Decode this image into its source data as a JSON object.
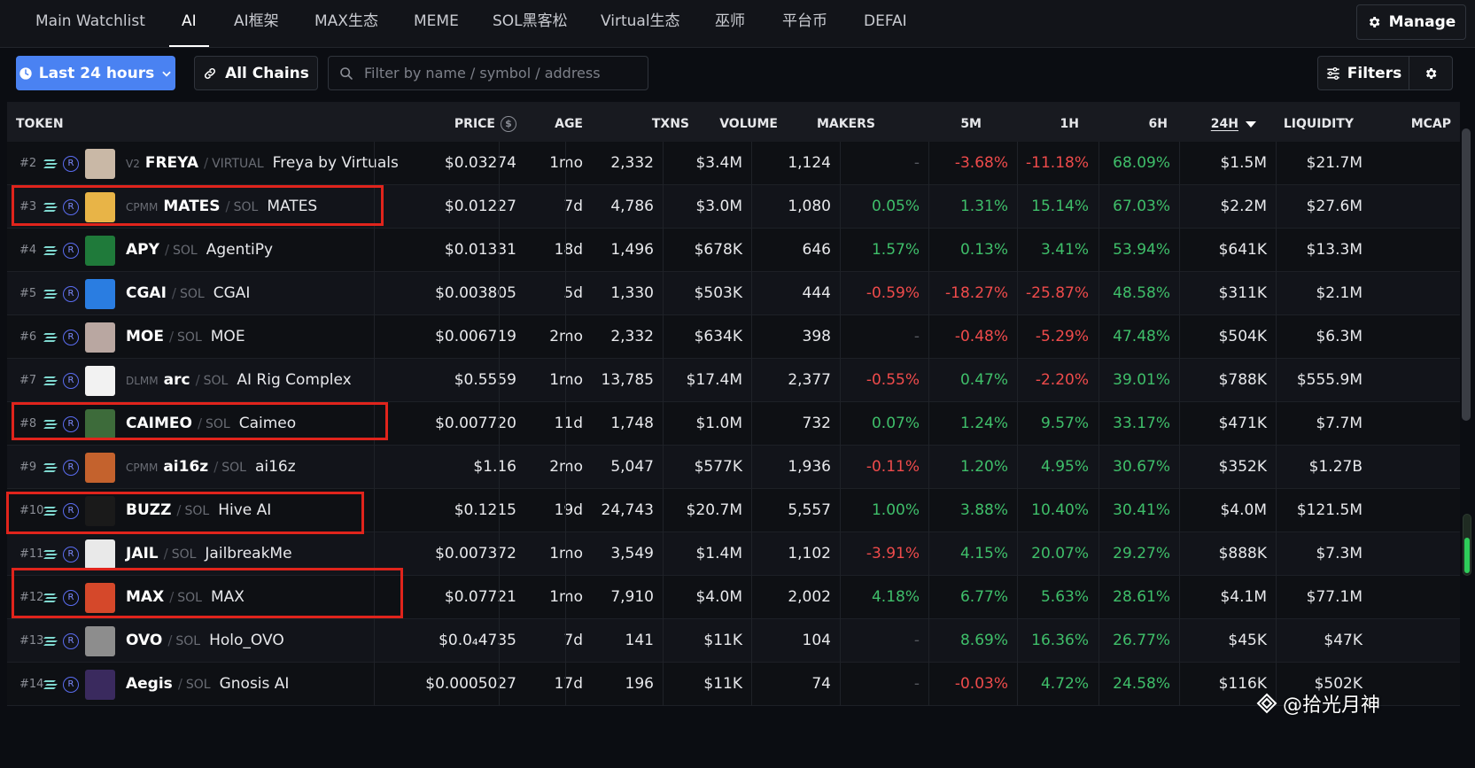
{
  "tabs": [
    "Main Watchlist",
    "AI",
    "AI框架",
    "MAX生态",
    "MEME",
    "SOL黑客松",
    "Virtual生态",
    "巫师",
    "平台币",
    "DEFAI"
  ],
  "active_tab": "AI",
  "manage_label": "Manage",
  "toolbar": {
    "time_label": "Last 24 hours",
    "chains_label": "All Chains",
    "search_placeholder": "Filter by name / symbol / address",
    "filters_label": "Filters"
  },
  "columns": {
    "token": "TOKEN",
    "price": "PRICE",
    "age": "AGE",
    "txns": "TXNS",
    "volume": "VOLUME",
    "makers": "MAKERS",
    "m5": "5M",
    "h1": "1H",
    "h6": "6H",
    "h24": "24H",
    "liquidity": "LIQUIDITY",
    "mcap": "MCAP"
  },
  "rows": [
    {
      "rank": "#2",
      "tag": "V2",
      "symbol": "FREYA",
      "quote": "VIRTUAL",
      "name": "Freya by Virtuals",
      "price": "$0.03274",
      "age": "1mo",
      "txns": "2,332",
      "volume": "$3.4M",
      "makers": "1,124",
      "m5": "-",
      "h1": "-3.68%",
      "h6": "-11.18%",
      "h24": "68.09%",
      "liquidity": "$1.5M",
      "mcap": "$21.7M",
      "avatar_color": "#c9b8a6"
    },
    {
      "rank": "#3",
      "tag": "CPMM",
      "symbol": "MATES",
      "quote": "SOL",
      "name": "MATES",
      "price": "$0.01227",
      "age": "7d",
      "txns": "4,786",
      "volume": "$3.0M",
      "makers": "1,080",
      "m5": "0.05%",
      "h1": "1.31%",
      "h6": "15.14%",
      "h24": "67.03%",
      "liquidity": "$2.2M",
      "mcap": "$27.6M",
      "avatar_color": "#e8b447"
    },
    {
      "rank": "#4",
      "tag": "",
      "symbol": "APY",
      "quote": "SOL",
      "name": "AgentiPy",
      "price": "$0.01331",
      "age": "18d",
      "txns": "1,496",
      "volume": "$678K",
      "makers": "646",
      "m5": "1.57%",
      "h1": "0.13%",
      "h6": "3.41%",
      "h24": "53.94%",
      "liquidity": "$641K",
      "mcap": "$13.3M",
      "avatar_color": "#1f7a3a"
    },
    {
      "rank": "#5",
      "tag": "",
      "symbol": "CGAI",
      "quote": "SOL",
      "name": "CGAI",
      "price": "$0.003805",
      "age": "5d",
      "txns": "1,330",
      "volume": "$503K",
      "makers": "444",
      "m5": "-0.59%",
      "h1": "-18.27%",
      "h6": "-25.87%",
      "h24": "48.58%",
      "liquidity": "$311K",
      "mcap": "$2.1M",
      "avatar_color": "#2a7de1"
    },
    {
      "rank": "#6",
      "tag": "",
      "symbol": "MOE",
      "quote": "SOL",
      "name": "MOE",
      "price": "$0.006719",
      "age": "2mo",
      "txns": "2,332",
      "volume": "$634K",
      "makers": "398",
      "m5": "-",
      "h1": "-0.48%",
      "h6": "-5.29%",
      "h24": "47.48%",
      "liquidity": "$504K",
      "mcap": "$6.3M",
      "avatar_color": "#b9a7a1"
    },
    {
      "rank": "#7",
      "tag": "DLMM",
      "symbol": "arc",
      "quote": "SOL",
      "name": "AI Rig Complex",
      "price": "$0.5559",
      "age": "1mo",
      "txns": "13,785",
      "volume": "$17.4M",
      "makers": "2,377",
      "m5": "-0.55%",
      "h1": "0.47%",
      "h6": "-2.20%",
      "h24": "39.01%",
      "liquidity": "$788K",
      "mcap": "$555.9M",
      "avatar_color": "#f2f2f2"
    },
    {
      "rank": "#8",
      "tag": "",
      "symbol": "CAIMEO",
      "quote": "SOL",
      "name": "Caimeo",
      "price": "$0.007720",
      "age": "11d",
      "txns": "1,748",
      "volume": "$1.0M",
      "makers": "732",
      "m5": "0.07%",
      "h1": "1.24%",
      "h6": "9.57%",
      "h24": "33.17%",
      "liquidity": "$471K",
      "mcap": "$7.7M",
      "avatar_color": "#3d6b3a"
    },
    {
      "rank": "#9",
      "tag": "CPMM",
      "symbol": "ai16z",
      "quote": "SOL",
      "name": "ai16z",
      "price": "$1.16",
      "age": "2mo",
      "txns": "5,047",
      "volume": "$577K",
      "makers": "1,936",
      "m5": "-0.11%",
      "h1": "1.20%",
      "h6": "4.95%",
      "h24": "30.67%",
      "liquidity": "$352K",
      "mcap": "$1.27B",
      "avatar_color": "#c4622d"
    },
    {
      "rank": "#10",
      "tag": "",
      "symbol": "BUZZ",
      "quote": "SOL",
      "name": "Hive AI",
      "price": "$0.1215",
      "age": "19d",
      "txns": "24,743",
      "volume": "$20.7M",
      "makers": "5,557",
      "m5": "1.00%",
      "h1": "3.88%",
      "h6": "10.40%",
      "h24": "30.41%",
      "liquidity": "$4.0M",
      "mcap": "$121.5M",
      "avatar_color": "#1a1a1a"
    },
    {
      "rank": "#11",
      "tag": "",
      "symbol": "JAIL",
      "quote": "SOL",
      "name": "JailbreakMe",
      "price": "$0.007372",
      "age": "1mo",
      "txns": "3,549",
      "volume": "$1.4M",
      "makers": "1,102",
      "m5": "-3.91%",
      "h1": "4.15%",
      "h6": "20.07%",
      "h24": "29.27%",
      "liquidity": "$888K",
      "mcap": "$7.3M",
      "avatar_color": "#e9e9e9"
    },
    {
      "rank": "#12",
      "tag": "",
      "symbol": "MAX",
      "quote": "SOL",
      "name": "MAX",
      "price": "$0.07721",
      "age": "1mo",
      "txns": "7,910",
      "volume": "$4.0M",
      "makers": "2,002",
      "m5": "4.18%",
      "h1": "6.77%",
      "h6": "5.63%",
      "h24": "28.61%",
      "liquidity": "$4.1M",
      "mcap": "$77.1M",
      "avatar_color": "#d5482a"
    },
    {
      "rank": "#13",
      "tag": "",
      "symbol": "OVO",
      "quote": "SOL",
      "name": "Holo_OVO",
      "price": "$0.0₄4735",
      "age": "7d",
      "txns": "141",
      "volume": "$11K",
      "makers": "104",
      "m5": "-",
      "h1": "8.69%",
      "h6": "16.36%",
      "h24": "26.77%",
      "liquidity": "$45K",
      "mcap": "$47K",
      "avatar_color": "#8d8d8d"
    },
    {
      "rank": "#14",
      "tag": "",
      "symbol": "Aegis",
      "quote": "SOL",
      "name": "Gnosis AI",
      "price": "$0.0005027",
      "age": "17d",
      "txns": "196",
      "volume": "$11K",
      "makers": "74",
      "m5": "-",
      "h1": "-0.03%",
      "h6": "4.72%",
      "h24": "24.58%",
      "liquidity": "$116K",
      "mcap": "$502K",
      "avatar_color": "#3a2a5e"
    }
  ],
  "watermark": "@拾光月神",
  "colors": {
    "accent": "#4a82f2",
    "positive": "#3fbf6a",
    "negative": "#ef4b4b",
    "highlight": "#e0241c"
  }
}
